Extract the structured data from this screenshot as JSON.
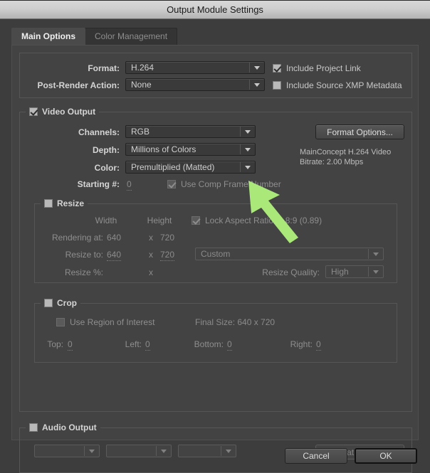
{
  "window": {
    "title": "Output Module Settings"
  },
  "tabs": [
    {
      "label": "Main Options",
      "active": true
    },
    {
      "label": "Color Management",
      "active": false
    }
  ],
  "top_section": {
    "format_label": "Format:",
    "format_value": "H.264",
    "post_render_label": "Post-Render Action:",
    "post_render_value": "None",
    "include_project_link": "Include Project Link",
    "include_xmp": "Include Source XMP Metadata"
  },
  "video_output": {
    "group_label": "Video Output",
    "channels_label": "Channels:",
    "channels_value": "RGB",
    "depth_label": "Depth:",
    "depth_value": "Millions of Colors",
    "color_label": "Color:",
    "color_value": "Premultiplied (Matted)",
    "starting_label": "Starting #:",
    "starting_value": "0",
    "use_comp_frame_number": "Use Comp Frame Number",
    "format_options_button": "Format Options...",
    "codec_info": "MainConcept H.264 Video\nBitrate: 2.00 Mbps"
  },
  "resize": {
    "group_label": "Resize",
    "width_header": "Width",
    "height_header": "Height",
    "lock_aspect": "Lock Aspect Ratio to 8:9 (0.89)",
    "rendering_at_label": "Rendering at:",
    "rendering_width": "640",
    "rendering_x": "x",
    "rendering_height": "720",
    "resize_to_label": "Resize to:",
    "resize_width": "640",
    "resize_x": "x",
    "resize_height": "720",
    "resize_preset": "Custom",
    "resize_pct_label": "Resize %:",
    "resize_pct_x": "x",
    "resize_quality_label": "Resize Quality:",
    "resize_quality_value": "High"
  },
  "crop": {
    "group_label": "Crop",
    "use_region_of_interest": "Use Region of Interest",
    "final_size": "Final Size: 640 x 720",
    "top_label": "Top:",
    "top_value": "0",
    "left_label": "Left:",
    "left_value": "0",
    "bottom_label": "Bottom:",
    "bottom_value": "0",
    "right_label": "Right:",
    "right_value": "0"
  },
  "audio_output": {
    "group_label": "Audio Output",
    "rate_value": "",
    "depth_value": "",
    "channels_value": "",
    "format_options_button": "Format Options..."
  },
  "footer": {
    "cancel": "Cancel",
    "ok": "OK"
  },
  "annotation": {
    "arrow_color": "#a9e879",
    "points_at": "channels-dropdown"
  },
  "colors": {
    "dialog_bg": "#3d3d3d",
    "panel_bg": "#434343",
    "titlebar": "#cfcfcf",
    "text": "#c8c8c8",
    "accent_arrow": "#a9e879"
  }
}
